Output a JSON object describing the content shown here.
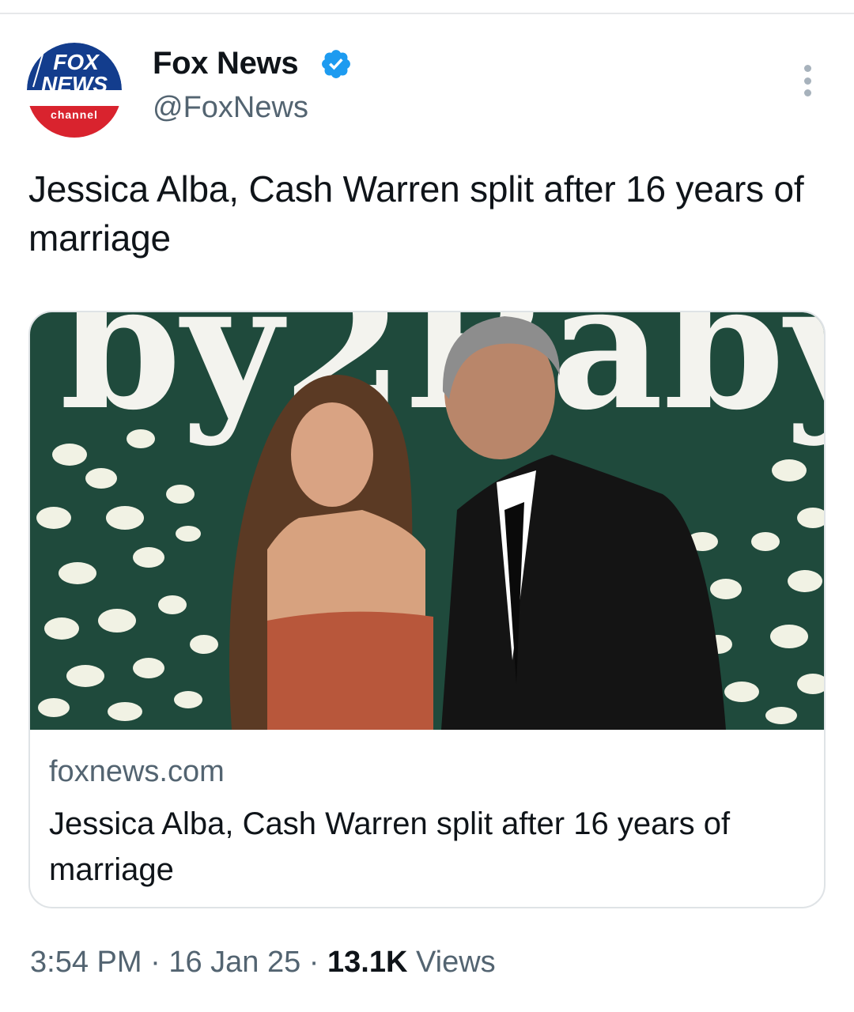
{
  "tweet": {
    "author": {
      "name": "Fox News",
      "handle": "@FoxNews",
      "verified": true,
      "avatar_logo": {
        "line1": "FOX",
        "line2": "NEWS",
        "line3": "channel"
      }
    },
    "text": "Jessica Alba, Cash Warren split after 16 years of marriage",
    "card": {
      "image_backdrop_text": "by2Baby",
      "domain": "foxnews.com",
      "title": "Jessica Alba, Cash Warren split after 16 years of marriage"
    },
    "meta": {
      "time": "3:54 PM",
      "date": "16 Jan 25",
      "separator": "·",
      "views_count": "13.1K",
      "views_label": "Views"
    }
  },
  "icons": [
    "verified-badge-icon",
    "more-options-icon"
  ],
  "colors": {
    "accent_verified": "#1d9bf0",
    "text_primary": "#0f1419",
    "text_secondary": "#536471",
    "border": "#dfe3e6"
  }
}
